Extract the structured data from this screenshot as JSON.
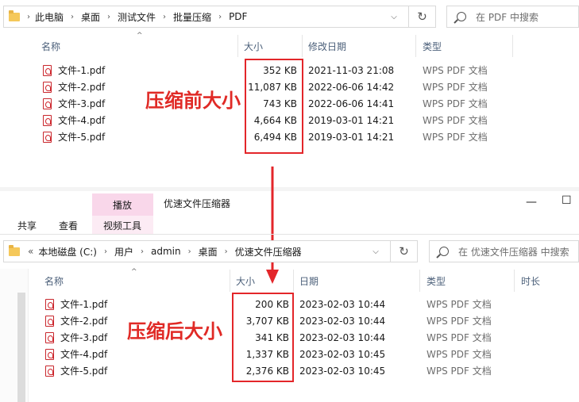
{
  "before": {
    "breadcrumb": [
      "此电脑",
      "桌面",
      "测试文件",
      "批量压缩",
      "PDF"
    ],
    "search_placeholder": "在 PDF 中搜索",
    "columns": {
      "name": "名称",
      "size": "大小",
      "date": "修改日期",
      "type": "类型"
    },
    "files": [
      {
        "name": "文件-1.pdf",
        "size": "352 KB",
        "date": "2021-11-03 21:08",
        "type": "WPS PDF 文档"
      },
      {
        "name": "文件-2.pdf",
        "size": "11,087 KB",
        "date": "2022-06-06 14:42",
        "type": "WPS PDF 文档"
      },
      {
        "name": "文件-3.pdf",
        "size": "743 KB",
        "date": "2022-06-06 14:41",
        "type": "WPS PDF 文档"
      },
      {
        "name": "文件-4.pdf",
        "size": "4,664 KB",
        "date": "2019-03-01 14:21",
        "type": "WPS PDF 文档"
      },
      {
        "name": "文件-5.pdf",
        "size": "6,494 KB",
        "date": "2019-03-01 14:21",
        "type": "WPS PDF 文档"
      }
    ],
    "annotation": "压缩前大小"
  },
  "after": {
    "window_title": "优速文件压缩器",
    "ribbon": {
      "play_tab": "播放",
      "share_tab": "共享",
      "view_tab": "查看",
      "video_tools": "视频工具"
    },
    "window_controls": {
      "minimize": "—",
      "restore": "☐"
    },
    "breadcrumb_overflow": "«",
    "breadcrumb": [
      "本地磁盘 (C:)",
      "用户",
      "admin",
      "桌面",
      "优速文件压缩器"
    ],
    "search_placeholder": "在 优速文件压缩器 中搜索",
    "columns": {
      "name": "名称",
      "size": "大小",
      "date": "日期",
      "type": "类型",
      "duration": "时长"
    },
    "files": [
      {
        "name": "文件-1.pdf",
        "size": "200 KB",
        "date": "2023-02-03 10:44",
        "type": "WPS PDF 文档"
      },
      {
        "name": "文件-2.pdf",
        "size": "3,707 KB",
        "date": "2023-02-03 10:44",
        "type": "WPS PDF 文档"
      },
      {
        "name": "文件-3.pdf",
        "size": "341 KB",
        "date": "2023-02-03 10:44",
        "type": "WPS PDF 文档"
      },
      {
        "name": "文件-4.pdf",
        "size": "1,337 KB",
        "date": "2023-02-03 10:45",
        "type": "WPS PDF 文档"
      },
      {
        "name": "文件-5.pdf",
        "size": "2,376 KB",
        "date": "2023-02-03 10:45",
        "type": "WPS PDF 文档"
      }
    ],
    "annotation": "压缩后大小"
  },
  "icons": {
    "chevron": "›",
    "dropdown": "⌵",
    "refresh": "↻",
    "sort_up": "^"
  },
  "colors": {
    "annotation_red": "#e3262a",
    "header_text": "#4c607a",
    "pink_tab": "#f9d7ea"
  }
}
